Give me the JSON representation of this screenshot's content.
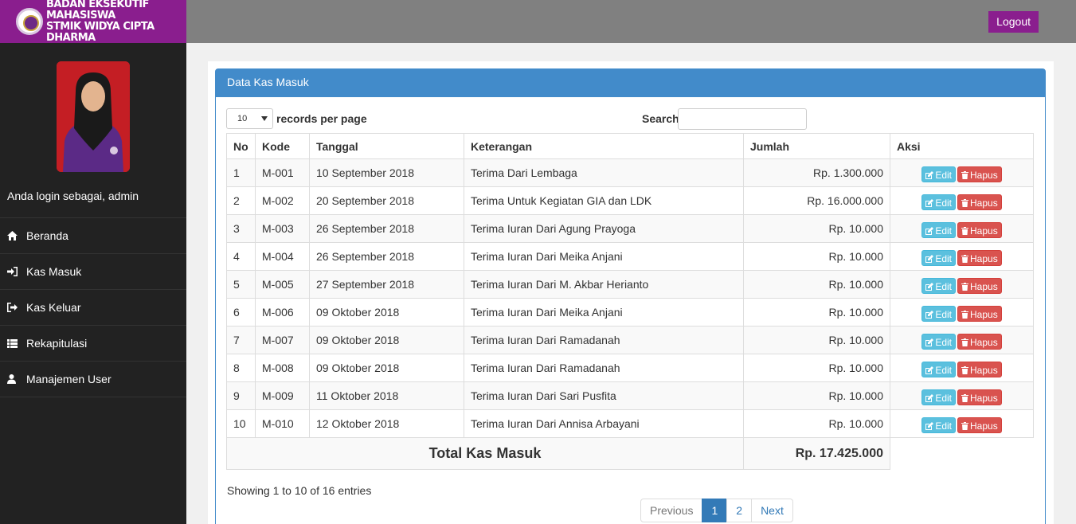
{
  "brand": {
    "line1": "BADAN EKSEKUTIF MAHASISWA",
    "line2": "STMIK WIDYA CIPTA DHARMA"
  },
  "header": {
    "logout_label": "Logout"
  },
  "sidebar": {
    "login_text": "Anda login sebagai, admin",
    "items": [
      {
        "label": "Beranda",
        "icon": "home-icon"
      },
      {
        "label": "Kas Masuk",
        "icon": "sign-in-icon"
      },
      {
        "label": "Kas Keluar",
        "icon": "sign-out-icon"
      },
      {
        "label": "Rekapitulasi",
        "icon": "list-icon"
      },
      {
        "label": "Manajemen User",
        "icon": "user-icon"
      }
    ]
  },
  "panel": {
    "title": "Data Kas Masuk"
  },
  "controls": {
    "page_length": "10",
    "length_label": "records per page",
    "search_label": "Search:",
    "search_value": ""
  },
  "table": {
    "headers": [
      "No",
      "Kode",
      "Tanggal",
      "Keterangan",
      "Jumlah",
      "Aksi"
    ],
    "edit_label": "Edit",
    "delete_label": "Hapus",
    "rows": [
      {
        "no": "1",
        "kode": "M-001",
        "tanggal": "10 September 2018",
        "keterangan": "Terima Dari Lembaga",
        "jumlah": "Rp. 1.300.000"
      },
      {
        "no": "2",
        "kode": "M-002",
        "tanggal": "20 September 2018",
        "keterangan": "Terima Untuk Kegiatan GIA dan LDK",
        "jumlah": "Rp. 16.000.000"
      },
      {
        "no": "3",
        "kode": "M-003",
        "tanggal": "26 September 2018",
        "keterangan": "Terima Iuran Dari Agung Prayoga",
        "jumlah": "Rp. 10.000"
      },
      {
        "no": "4",
        "kode": "M-004",
        "tanggal": "26 September 2018",
        "keterangan": "Terima Iuran Dari Meika Anjani",
        "jumlah": "Rp. 10.000"
      },
      {
        "no": "5",
        "kode": "M-005",
        "tanggal": "27 September 2018",
        "keterangan": "Terima Iuran Dari M. Akbar Herianto",
        "jumlah": "Rp. 10.000"
      },
      {
        "no": "6",
        "kode": "M-006",
        "tanggal": "09 Oktober 2018",
        "keterangan": "Terima Iuran Dari Meika Anjani",
        "jumlah": "Rp. 10.000"
      },
      {
        "no": "7",
        "kode": "M-007",
        "tanggal": "09 Oktober 2018",
        "keterangan": "Terima Iuran Dari Ramadanah",
        "jumlah": "Rp. 10.000"
      },
      {
        "no": "8",
        "kode": "M-008",
        "tanggal": "09 Oktober 2018",
        "keterangan": "Terima Iuran Dari Ramadanah",
        "jumlah": "Rp. 10.000"
      },
      {
        "no": "9",
        "kode": "M-009",
        "tanggal": "11 Oktober 2018",
        "keterangan": "Terima Iuran Dari Sari Pusfita",
        "jumlah": "Rp. 10.000"
      },
      {
        "no": "10",
        "kode": "M-010",
        "tanggal": "12 Oktober 2018",
        "keterangan": "Terima Iuran Dari Annisa Arbayani",
        "jumlah": "Rp. 10.000"
      }
    ],
    "total_label": "Total Kas Masuk",
    "total_value": "Rp. 17.425.000"
  },
  "footer": {
    "info": "Showing 1 to 10 of 16 entries",
    "pagination": {
      "previous": "Previous",
      "pages": [
        "1",
        "2"
      ],
      "active_page": "1",
      "next": "Next"
    }
  },
  "colors": {
    "brand": "#8a1e8e",
    "topbar": "#808080",
    "sidebar": "#222222",
    "panel_head": "#428bca",
    "edit": "#5bc0de",
    "delete": "#d9534f"
  }
}
